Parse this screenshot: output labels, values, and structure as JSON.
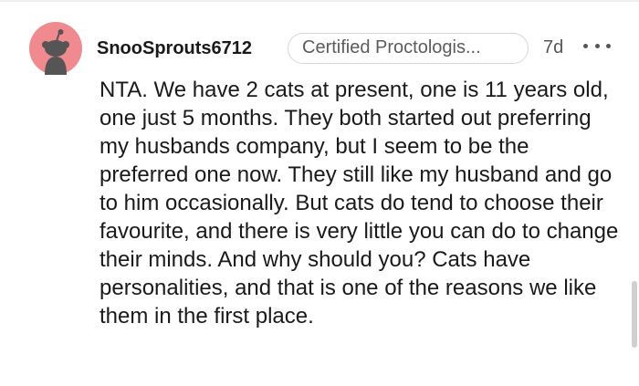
{
  "comment": {
    "username": "SnooSprouts6712",
    "flair": "Certified Proctologis...",
    "timestamp": "7d",
    "more_icon": "more-horizontal-icon",
    "avatar_icon": "snoo-avatar-icon",
    "body": "NTA. We have 2 cats at present, one is 11 years old, one just 5 months. They both started out preferring my husbands company, but I seem to be the preferred one now. They still like my husband and go to him occasionally. But cats do tend to choose their favourite, and there is very little you can do to change their minds. And why should you? Cats have personalities, and that is one of the reasons we like them in the first place."
  },
  "colors": {
    "avatar_bg": "#f08a8f",
    "avatar_figure": "#555555",
    "text": "#1a1a1b",
    "muted": "#555555",
    "flair_border": "#d6d6d6"
  }
}
